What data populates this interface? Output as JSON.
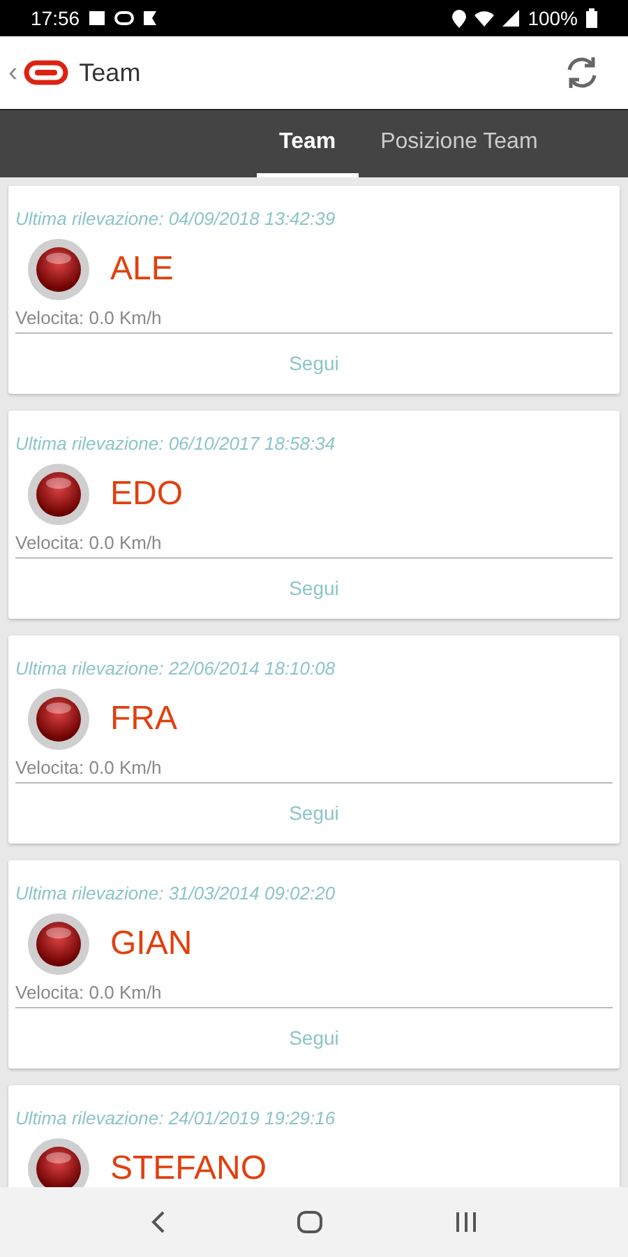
{
  "status_bar": {
    "time": "17:56",
    "battery": "100%"
  },
  "app_bar": {
    "back": "‹",
    "title": "Team"
  },
  "tabs": [
    {
      "label": "Team",
      "selected": true
    },
    {
      "label": "Posizione Team",
      "selected": false
    }
  ],
  "members": [
    {
      "last_seen": "Ultima rilevazione: 04/09/2018 13:42:39",
      "name": "ALE",
      "speed": "Velocita: 0.0 Km/h",
      "follow": "Segui"
    },
    {
      "last_seen": "Ultima rilevazione: 06/10/2017 18:58:34",
      "name": "EDO",
      "speed": "Velocita: 0.0 Km/h",
      "follow": "Segui"
    },
    {
      "last_seen": "Ultima rilevazione: 22/06/2014 18:10:08",
      "name": "FRA",
      "speed": "Velocita: 0.0 Km/h",
      "follow": "Segui"
    },
    {
      "last_seen": "Ultima rilevazione: 31/03/2014 09:02:20",
      "name": "GIAN",
      "speed": "Velocita: 0.0 Km/h",
      "follow": "Segui"
    },
    {
      "last_seen": "Ultima rilevazione: 24/01/2019 19:29:16",
      "name": "STEFANO"
    }
  ]
}
